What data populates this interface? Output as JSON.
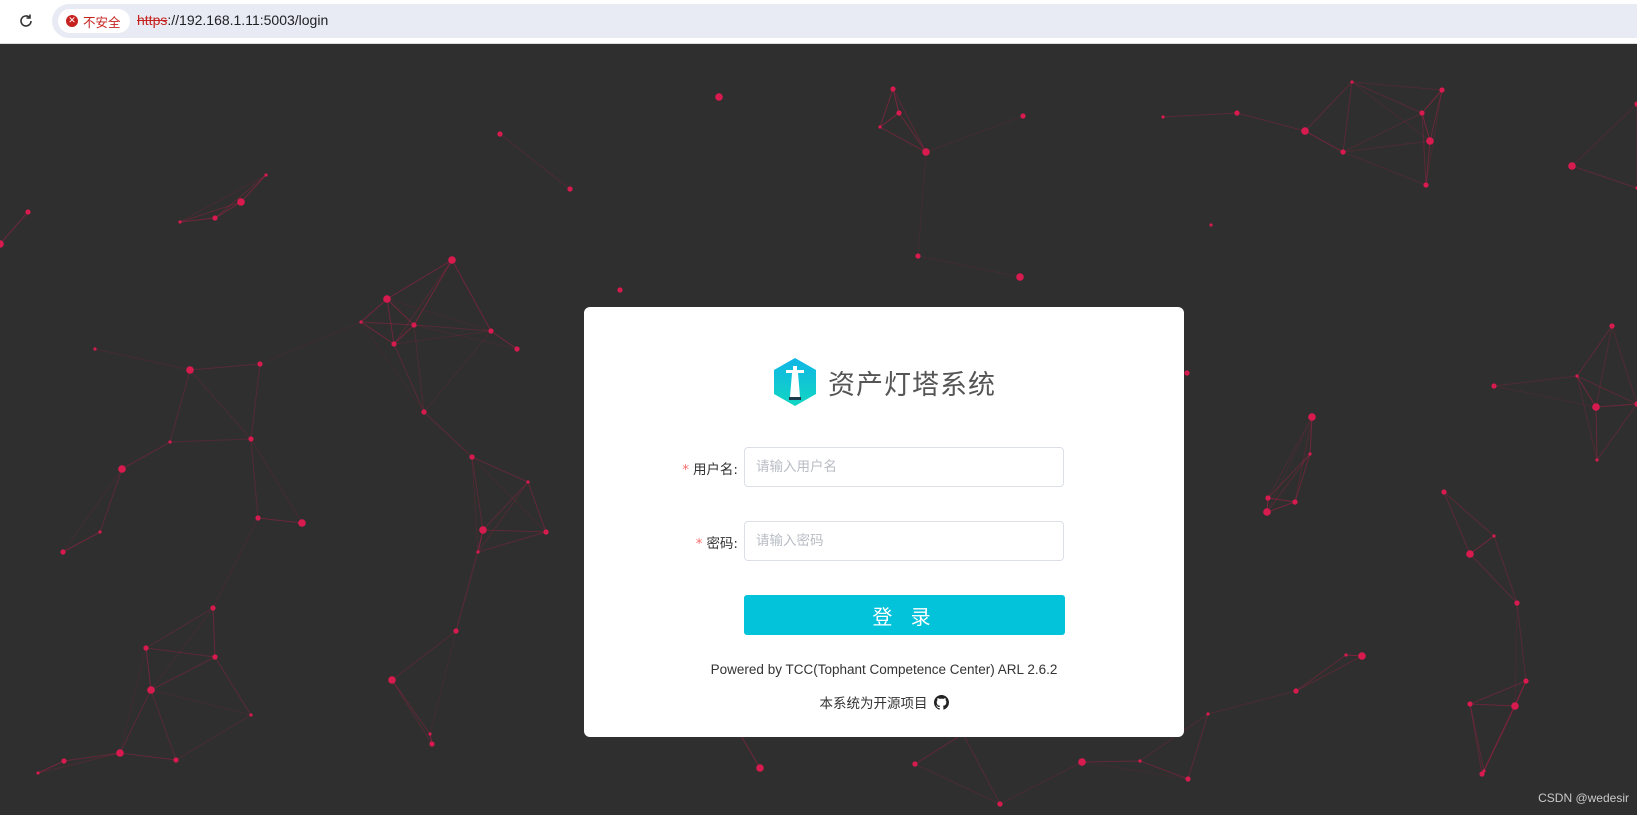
{
  "browser": {
    "security_label": "不安全",
    "url_scheme": "https",
    "url_rest": "://192.168.1.11:5003/login",
    "reload_icon": "reload-icon",
    "warning_icon": "insecure-warning-icon"
  },
  "login": {
    "title": "资产灯塔系统",
    "username": {
      "label": "用户名:",
      "placeholder": "请输入用户名",
      "value": ""
    },
    "password": {
      "label": "密码:",
      "placeholder": "请输入密码",
      "value": ""
    },
    "submit_label": "登 录",
    "powered_by": "Powered by TCC(Tophant Competence Center) ARL 2.6.2",
    "open_source_text": "本系统为开源项目",
    "github_icon": "github-icon"
  },
  "colors": {
    "accent": "#03c3da",
    "background": "#2f2f2f",
    "particle": "#d81b4f",
    "required_mark": "#f56c6c",
    "insecure": "#c5221f"
  },
  "watermark": "CSDN @wedesir"
}
